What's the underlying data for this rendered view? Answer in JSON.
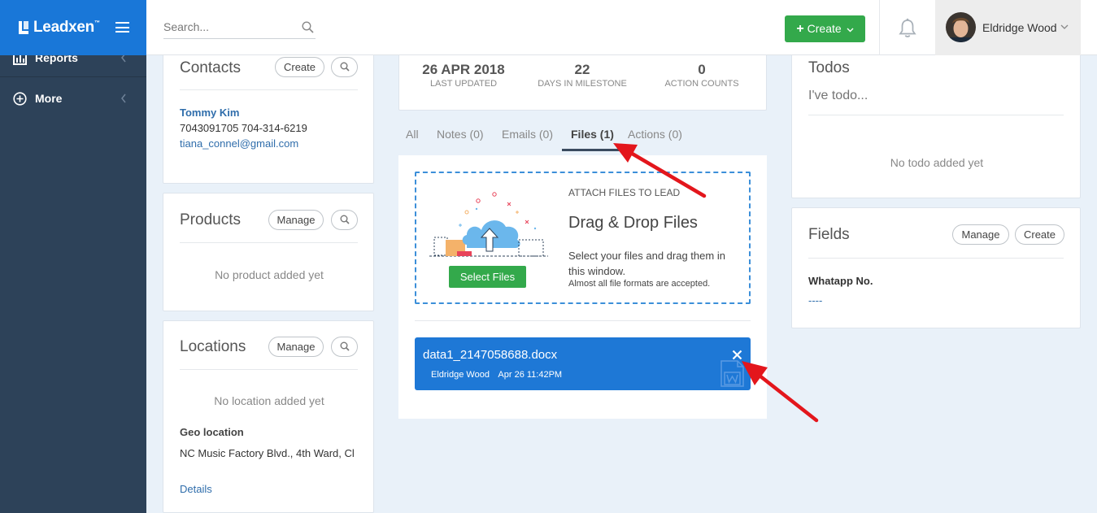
{
  "brand": {
    "name": "Leadxen",
    "tm": "™"
  },
  "sidebar": {
    "items": [
      {
        "label": "Reports",
        "icon": "bar-chart-icon"
      },
      {
        "label": "More",
        "icon": "plus-circle-icon"
      }
    ]
  },
  "header": {
    "search_placeholder": "Search...",
    "create_label": "Create",
    "create_prefix": "+",
    "user_name": "Eldridge Wood"
  },
  "contacts": {
    "title": "Contacts",
    "create_label": "Create",
    "name": "Tommy Kim",
    "phones": "7043091705 704-314-6219",
    "email": "tiana_connel@gmail.com"
  },
  "products": {
    "title": "Products",
    "manage_label": "Manage",
    "empty": "No product added yet"
  },
  "locations": {
    "title": "Locations",
    "manage_label": "Manage",
    "empty": "No location added yet",
    "geo_label": "Geo location",
    "geo_value": "NC Music Factory Blvd., 4th Ward, Cl",
    "details_link": "Details"
  },
  "stats": [
    {
      "value": "26 APR 2018",
      "label": "LAST UPDATED"
    },
    {
      "value": "22",
      "label": "DAYS IN MILESTONE"
    },
    {
      "value": "0",
      "label": "ACTION COUNTS"
    }
  ],
  "tabs": [
    {
      "label": "All"
    },
    {
      "label": "Notes (0)"
    },
    {
      "label": "Emails (0)"
    },
    {
      "label": "Files (1)"
    },
    {
      "label": "Actions (0)"
    }
  ],
  "dropzone": {
    "kicker": "ATTACH FILES TO LEAD",
    "title": "Drag & Drop Files",
    "description": "Select your files and drag them in this window.",
    "note": "Almost all file formats are accepted.",
    "button_label": "Select Files"
  },
  "file": {
    "name": "data1_2147058688.docx",
    "author": "Eldridge Wood",
    "date": "Apr 26 11:42PM"
  },
  "todos": {
    "title": "Todos",
    "placeholder": "I've todo...",
    "empty": "No todo added yet"
  },
  "fields": {
    "title": "Fields",
    "manage_label": "Manage",
    "create_label": "Create",
    "field_label": "Whatapp No.",
    "field_value": "----"
  },
  "colors": {
    "brand_blue": "#1977d8",
    "sidebar": "#2d4259",
    "create_green": "#33a94b",
    "file_blue": "#1e78d6",
    "arrow_red": "#e3161c"
  }
}
